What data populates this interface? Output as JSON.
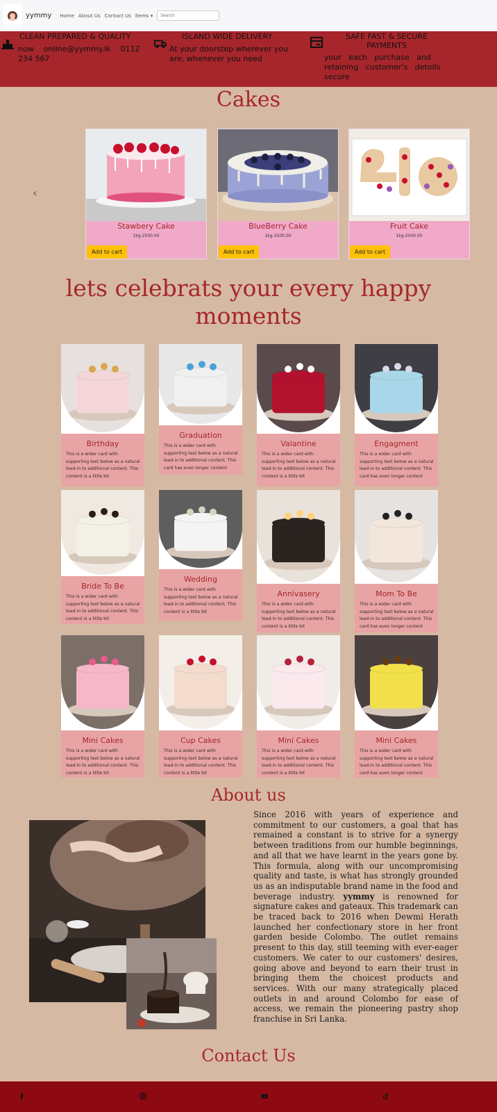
{
  "navbar": {
    "brand": "yymmy",
    "links": [
      "Home",
      "About Us",
      "Contact Us"
    ],
    "items_label": "Items",
    "items_caret": "▾",
    "search_placeholder": "Search"
  },
  "features": [
    {
      "icon": "chef-icon",
      "title": "CLEAN PREPARED & QUALITY",
      "line1": "now    online@yymmy.lk    0112",
      "line2": "234 567"
    },
    {
      "icon": "truck-icon",
      "title": "ISLAND WIDE DELIVERY",
      "line1": "At your doorstep wherever you",
      "line2": "are, whenever you need"
    },
    {
      "icon": "card-icon",
      "title_line1": "SAFE FAST & SECURE",
      "title_line2": "PAYMENTS",
      "line1": "your   each   purchase   and",
      "line2": "retaining   customer's   detoils",
      "line3": "secure"
    }
  ],
  "cakes": {
    "heading": "Cakes",
    "prev_icon": "‹",
    "products": [
      {
        "name": "Stawbery Cake",
        "price": "1kg-2500.00",
        "button": "Add to cart"
      },
      {
        "name": "BlueBerry Cake",
        "price": "1kg-2500.00",
        "button": "Add to cart"
      },
      {
        "name": "Fruit Cake",
        "price": "1kg-2500.00",
        "button": "Add to cart"
      }
    ]
  },
  "celebrate": {
    "heading_line1": "lets celebrats your every happy",
    "heading_line2": "moments",
    "cards": [
      {
        "title": "Birthday",
        "l1": "This is a wider card with",
        "l2": "supporting text below as a natural",
        "l3": "lead-in to additional content. This",
        "l4": "content is a little bit"
      },
      {
        "title": "Graduation",
        "l1": "This is a wider card with",
        "l2": "supporting text below as a natural",
        "l3": "lead-in to additional content. This",
        "l4": "card has even longer content"
      },
      {
        "title": "Valantine",
        "l1": "This is a wider card with",
        "l2": "supporting text below as a natural",
        "l3": "lead-in to additional content. This",
        "l4": "content is a little bit"
      },
      {
        "title": "Engagment",
        "l1": "This is a wider card with",
        "l2": "supporting text below as a natural",
        "l3": "lead-in to additional content. This",
        "l4": "card has even longer content"
      },
      {
        "title": "Bride To Be",
        "l1": "This is a wider card with",
        "l2": "supporting text below as a natural",
        "l3": "lead-in to additional content. This",
        "l4": "content is a little bit"
      },
      {
        "title": "Wedding",
        "l1": "This is a wider card with",
        "l2": "supporting text below as a natural",
        "l3": "lead-in to additional content. This",
        "l4": "content is a little bit"
      },
      {
        "title": "Annivasery",
        "l1": "This is a wider card with",
        "l2": "supporting text below as a natural",
        "l3": "lead-in to additional content. This",
        "l4": "content is a little bit"
      },
      {
        "title": "Mom To Be",
        "l1": "This is a wider card with",
        "l2": "supporting text below as a natural",
        "l3": "lead-in to additional content. This",
        "l4": "card has even longer content"
      },
      {
        "title": "Mini Cakes",
        "l1": "This is a wider card with",
        "l2": "supporting text below as a natural",
        "l3": "lead-in to additional content. This",
        "l4": "content is a little bit"
      },
      {
        "title": "Cup Cakes",
        "l1": "This is a wider card with",
        "l2": "supporting text below as a natural",
        "l3": "lead-in to additional content. This",
        "l4": "content is a little bit"
      },
      {
        "title": "Mini Cakes",
        "l1": "This is a wider card with",
        "l2": "supporting text below as a natural",
        "l3": "lead-in to additional content. This",
        "l4": "content is a little bit"
      },
      {
        "title": "Mini Cakes",
        "l1": "This is a wider card with",
        "l2": "supporting text below as a natural",
        "l3": "lead-in to additional content. This",
        "l4": "card has even longer content"
      }
    ]
  },
  "about": {
    "heading": "About us",
    "p1": "Since 2016 with years of experience and commitment to our customers, a goal that has remained a constant is to strive for a synergy between traditions from our humble beginnings, and all that we have learnt in the years gone by. This formula, along with our uncompromising quality and taste, is what has strongly grounded us as an indisputable brand name in the food and beverage industry. ",
    "brand": "yymmy",
    "p2": " is renowned for signature cakes and gateaux. This trademark can be traced back to 2016 when Dewmi Herath launched her confectionary store in her front garden beside Colombo. The outlet remains present to this day, still teeming with ever-eager customers. We cater to our customers' desires, going above and beyond to earn their trust in bringing them the choicest products and services. With our many strategically placed outlets in and around Colombo for ease of access, we remain the pioneering pastry shop franchise in Sri Lanka."
  },
  "contact": {
    "heading": "Contact Us"
  },
  "footer": {
    "icons": [
      "facebook-icon",
      "instagram-icon",
      "youtube-icon",
      "tiktok-icon"
    ]
  },
  "colors": {
    "accent": "#a6262b",
    "page_bg": "#d6b9a3",
    "card_pink": "#e8a4a4",
    "product_pink": "#f0a9c8",
    "button_yellow": "#ffc107",
    "footer": "#8e0a12"
  }
}
